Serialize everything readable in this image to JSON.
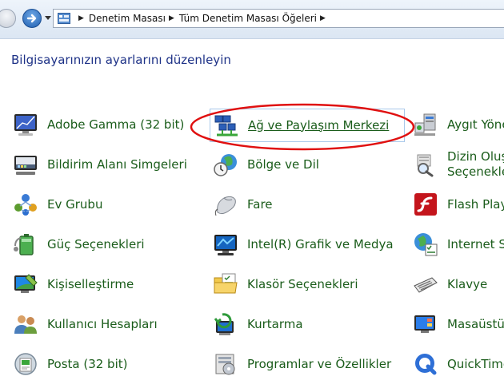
{
  "address_bar": {
    "crumbs": [
      "Denetim Masası",
      "Tüm Denetim Masası Öğeleri"
    ]
  },
  "page_title": "Bilgisayarınızın ayarlarını düzenleyin",
  "items": [
    {
      "label": "Adobe Gamma (32 bit)",
      "icon": "monitor-gamma-icon"
    },
    {
      "label": "Ağ ve Paylaşım Merkezi",
      "icon": "network-icon"
    },
    {
      "label": "Aygıt Yöne",
      "icon": "device-manager-icon"
    },
    {
      "label": "Bildirim Alanı Simgeleri",
      "icon": "notification-area-icon"
    },
    {
      "label": "Bölge ve Dil",
      "icon": "globe-clock-icon"
    },
    {
      "label": "Dizin Oluş",
      "label2": "Seçenekleri",
      "icon": "indexing-icon"
    },
    {
      "label": "Ev Grubu",
      "icon": "homegroup-icon"
    },
    {
      "label": "Fare",
      "icon": "mouse-icon"
    },
    {
      "label": "Flash Playe",
      "icon": "flash-icon"
    },
    {
      "label": "Güç Seçenekleri",
      "icon": "power-battery-icon"
    },
    {
      "label": "Intel(R) Grafik ve Medya",
      "icon": "intel-graphics-icon"
    },
    {
      "label": "Internet Se",
      "icon": "internet-options-icon"
    },
    {
      "label": "Kişiselleştirme",
      "icon": "personalization-icon"
    },
    {
      "label": "Klasör Seçenekleri",
      "icon": "folder-options-icon"
    },
    {
      "label": "Klavye",
      "icon": "keyboard-icon"
    },
    {
      "label": "Kullanıcı Hesapları",
      "icon": "user-accounts-icon"
    },
    {
      "label": "Kurtarma",
      "icon": "recovery-icon"
    },
    {
      "label": "Masaüstü",
      "icon": "desktop-gadgets-icon"
    },
    {
      "label": "Posta (32 bit)",
      "icon": "mail-icon"
    },
    {
      "label": "Programlar ve Özellikler",
      "icon": "programs-icon"
    },
    {
      "label": "QuickTime",
      "icon": "quicktime-icon"
    }
  ],
  "colors": {
    "link_green": "#1a5c1a",
    "title_blue": "#1e3287",
    "annotation_red": "#e01010"
  }
}
